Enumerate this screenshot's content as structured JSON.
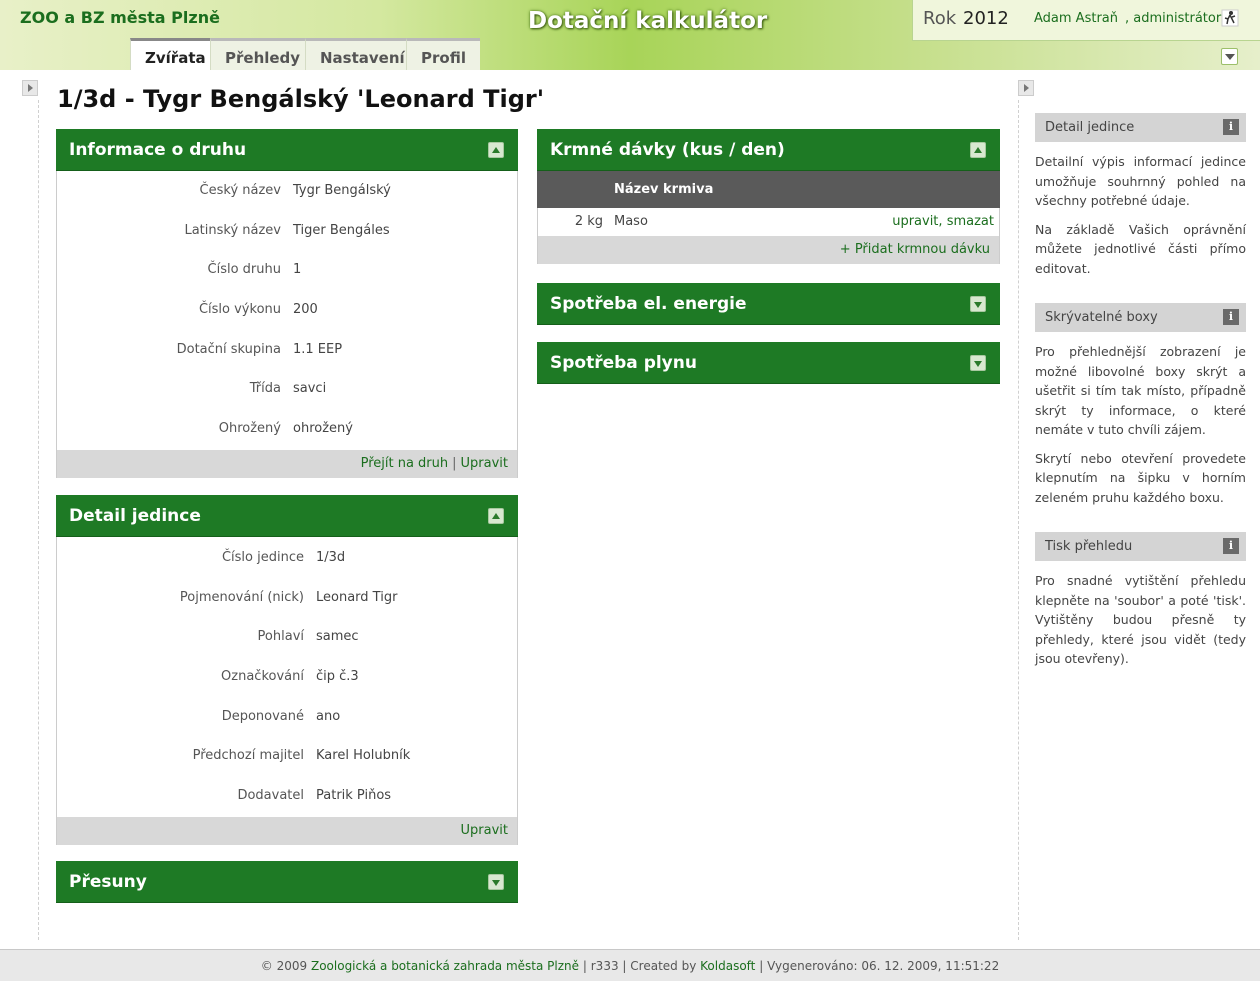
{
  "header": {
    "site_name": "ZOO a BZ města Plzně",
    "app_title": "Dotační kalkulátor",
    "year_label": "Rok",
    "year_value": "2012",
    "user_name": "Adam  Astraň",
    "user_role": ", administrátor",
    "logout_icon": "logout-icon"
  },
  "tabs": [
    {
      "label": "Zvířata",
      "active": true
    },
    {
      "label": "Přehledy",
      "active": false
    },
    {
      "label": "Nastavení",
      "active": false
    },
    {
      "label": "Profil",
      "active": false
    }
  ],
  "page_title": "1/3d - Tygr Bengálský 'Leonard Tigr'",
  "species_box": {
    "title": "Informace o druhu",
    "fields": [
      {
        "label": "Český název",
        "value": "Tygr Bengálský"
      },
      {
        "label": "Latinský název",
        "value": "Tiger Bengáles"
      },
      {
        "label": "Číslo druhu",
        "value": "1"
      },
      {
        "label": "Číslo výkonu",
        "value": "200"
      },
      {
        "label": "Dotační skupina",
        "value": "1.1 EEP"
      },
      {
        "label": "Třída",
        "value": "savci"
      },
      {
        "label": "Ohrožený",
        "value": "ohrožený"
      }
    ],
    "link_goto": "Přejít na druh",
    "link_edit": "Upravit"
  },
  "individual_box": {
    "title": "Detail jedince",
    "fields": [
      {
        "label": "Číslo jedince",
        "value": "1/3d"
      },
      {
        "label": "Pojmenování (nick)",
        "value": "Leonard Tigr"
      },
      {
        "label": "Pohlaví",
        "value": "samec"
      },
      {
        "label": "Označkování",
        "value": "čip č.3"
      },
      {
        "label": "Deponované",
        "value": "ano"
      },
      {
        "label": "Předchozí majitel",
        "value": "Karel Holubník"
      },
      {
        "label": "Dodavatel",
        "value": "Patrik Piňos"
      }
    ],
    "link_edit": "Upravit"
  },
  "transfers_box": {
    "title": "Přesuny"
  },
  "feed_box": {
    "title": "Krmné dávky (kus / den)",
    "column_header": "Název krmiva",
    "rows": [
      {
        "amount": "2 kg",
        "name": "Maso",
        "action_edit": "upravit",
        "action_sep": ",",
        "action_delete": "smazat"
      }
    ],
    "add_link": "+ Přidat krmnou dávku"
  },
  "energy_box": {
    "title": "Spotřeba el. energie"
  },
  "gas_box": {
    "title": "Spotřeba plynu"
  },
  "sidebar": {
    "help": [
      {
        "title": "Detail jedince",
        "paragraphs": [
          "Detailní výpis informací jedince umožňuje souhrnný pohled na všechny potřebné údaje.",
          "Na základě Vašich oprávnění můžete jednotlivé části přímo editovat."
        ]
      },
      {
        "title": "Skrývatelné boxy",
        "paragraphs": [
          "Pro přehlednější zobrazení je možné libovolné boxy skrýt a ušetřit si tím tak místo, případně skrýt ty informace, o které nemáte v tuto chvíli zájem.",
          "Skrytí nebo otevření provedete klepnutím na šipku v horním zeleném pruhu každého boxu."
        ]
      },
      {
        "title": "Tisk přehledu",
        "paragraphs": [
          "Pro snadné vytištění přehledu klepněte na 'soubor' a poté 'tisk'. Vytištěny budou přesně ty přehledy, které jsou vidět (tedy jsou otevřeny)."
        ]
      }
    ]
  },
  "footer": {
    "copy": "© 2009",
    "org_link": "Zoologická a botanická zahrada města Plzně",
    "sep1": "|",
    "revision": "r333",
    "sep2": "|",
    "created_by": "Created by",
    "author_link": "Koldasoft",
    "sep3": "|",
    "generated": "Vygenerováno: 06. 12. 2009, 11:51:22"
  },
  "colors": {
    "accent_green": "#1e7a25",
    "link_green": "#1b6e1e",
    "table_header": "#5a5a5a"
  }
}
